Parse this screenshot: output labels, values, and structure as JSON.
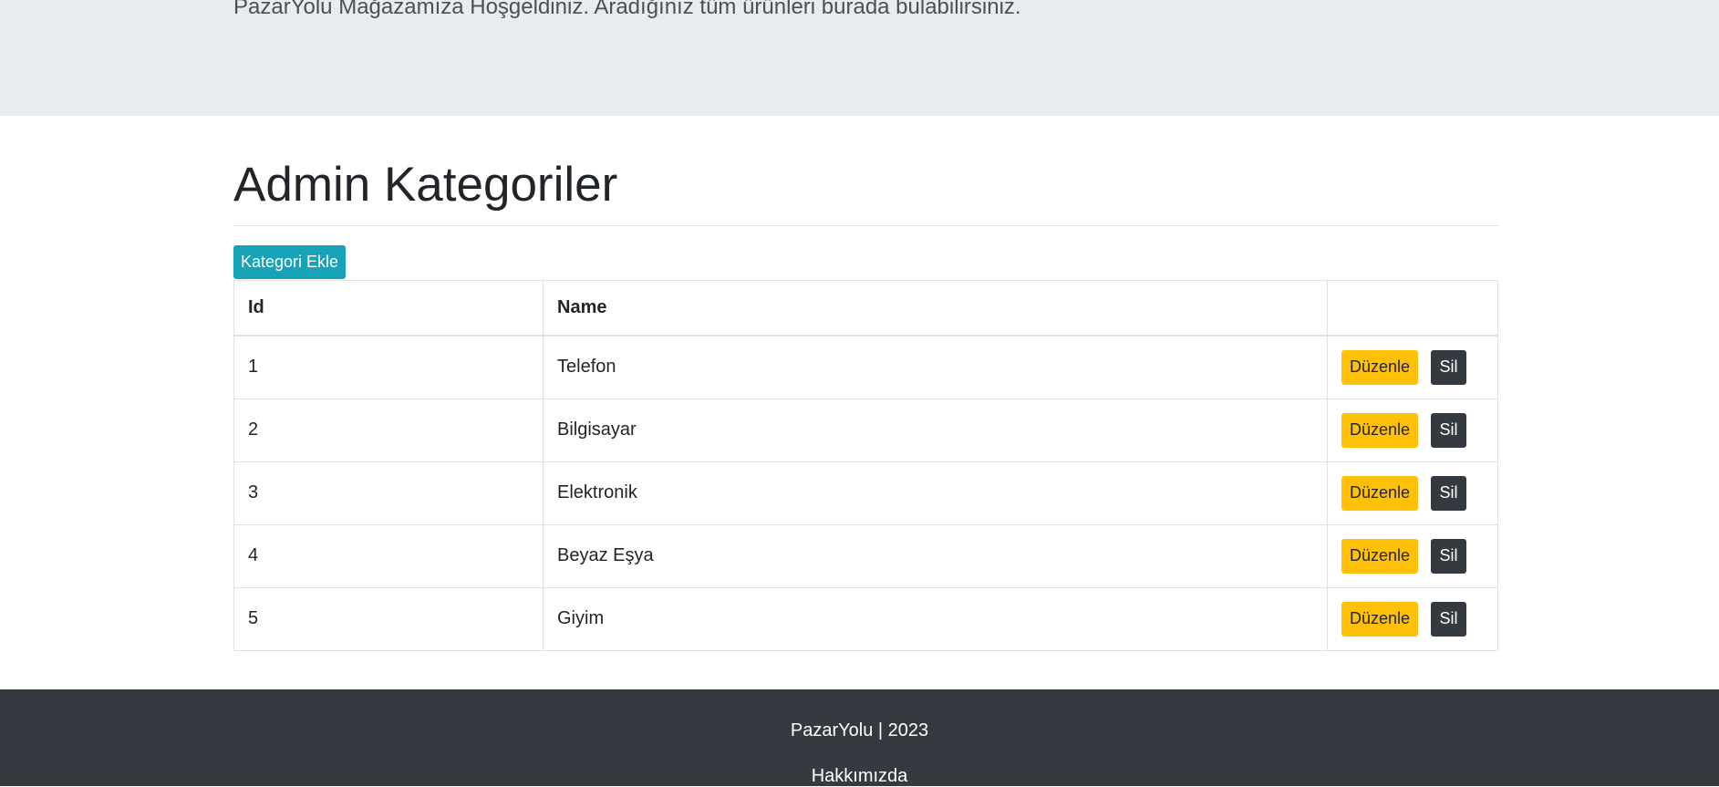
{
  "jumbotron": {
    "lead": "PazarYolu Mağazamıza Hoşgeldiniz. Aradığınız tüm ürünleri burada bulabilirsiniz."
  },
  "page": {
    "title": "Admin Kategoriler",
    "add_button": "Kategori Ekle"
  },
  "table": {
    "headers": [
      "Id",
      "Name",
      ""
    ],
    "rows": [
      {
        "id": "1",
        "name": "Telefon"
      },
      {
        "id": "2",
        "name": "Bilgisayar"
      },
      {
        "id": "3",
        "name": "Elektronik"
      },
      {
        "id": "4",
        "name": "Beyaz Eşya"
      },
      {
        "id": "5",
        "name": "Giyim"
      }
    ],
    "edit_label": "Düzenle",
    "delete_label": "Sil"
  },
  "footer": {
    "copyright": "PazarYolu | 2023",
    "about_link": "Hakkımızda"
  },
  "colors": {
    "jumbotron_bg": "#e9ecef",
    "info": "#17a2b8",
    "warning": "#ffc107",
    "dark": "#343a40"
  }
}
